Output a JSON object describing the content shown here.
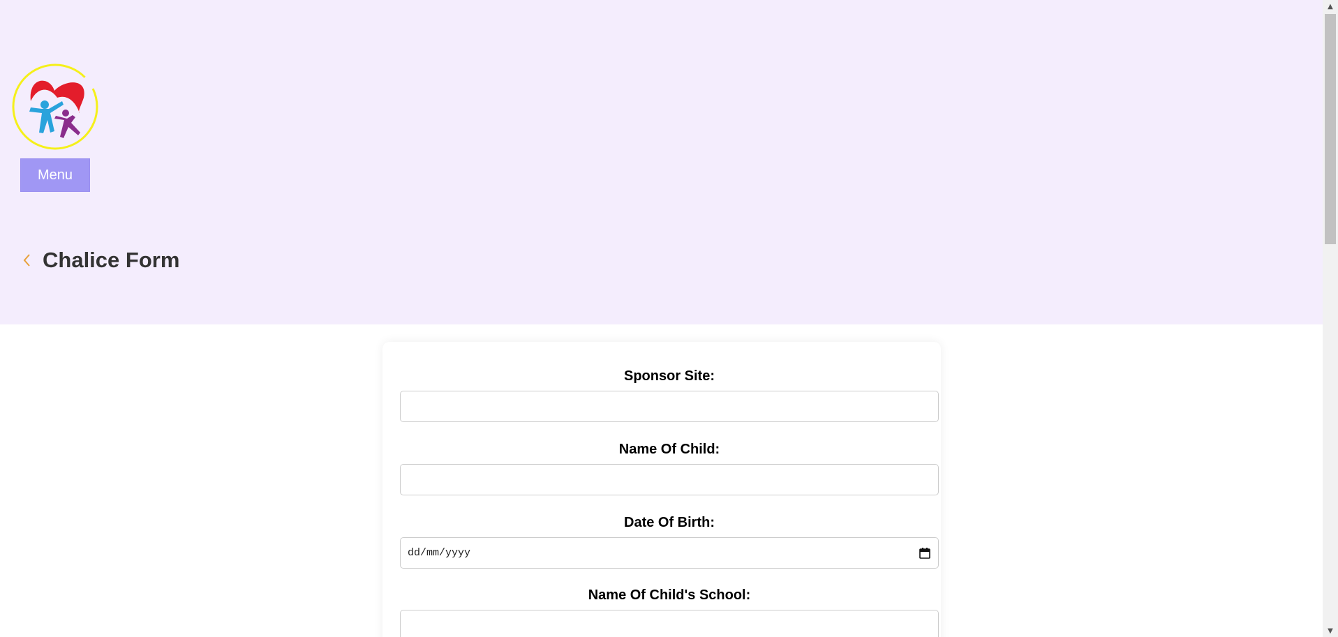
{
  "header": {
    "logo_icon": "family-heart-logo",
    "menu_label": "Menu",
    "back_icon": "chevron-left-icon",
    "title": "Chalice Form"
  },
  "form": {
    "fields": [
      {
        "label": "Sponsor Site:",
        "value": "",
        "type": "text"
      },
      {
        "label": "Name Of Child:",
        "value": "",
        "type": "text"
      },
      {
        "label": "Date Of Birth:",
        "value": "",
        "placeholder": "dd/mm/yyyy",
        "type": "date"
      },
      {
        "label": "Name Of Child's School:",
        "value": "",
        "type": "text"
      }
    ]
  },
  "colors": {
    "header_bg": "#f4edfd",
    "menu_bg": "#a097f4",
    "back_icon": "#e8a13a",
    "title": "#333333"
  }
}
